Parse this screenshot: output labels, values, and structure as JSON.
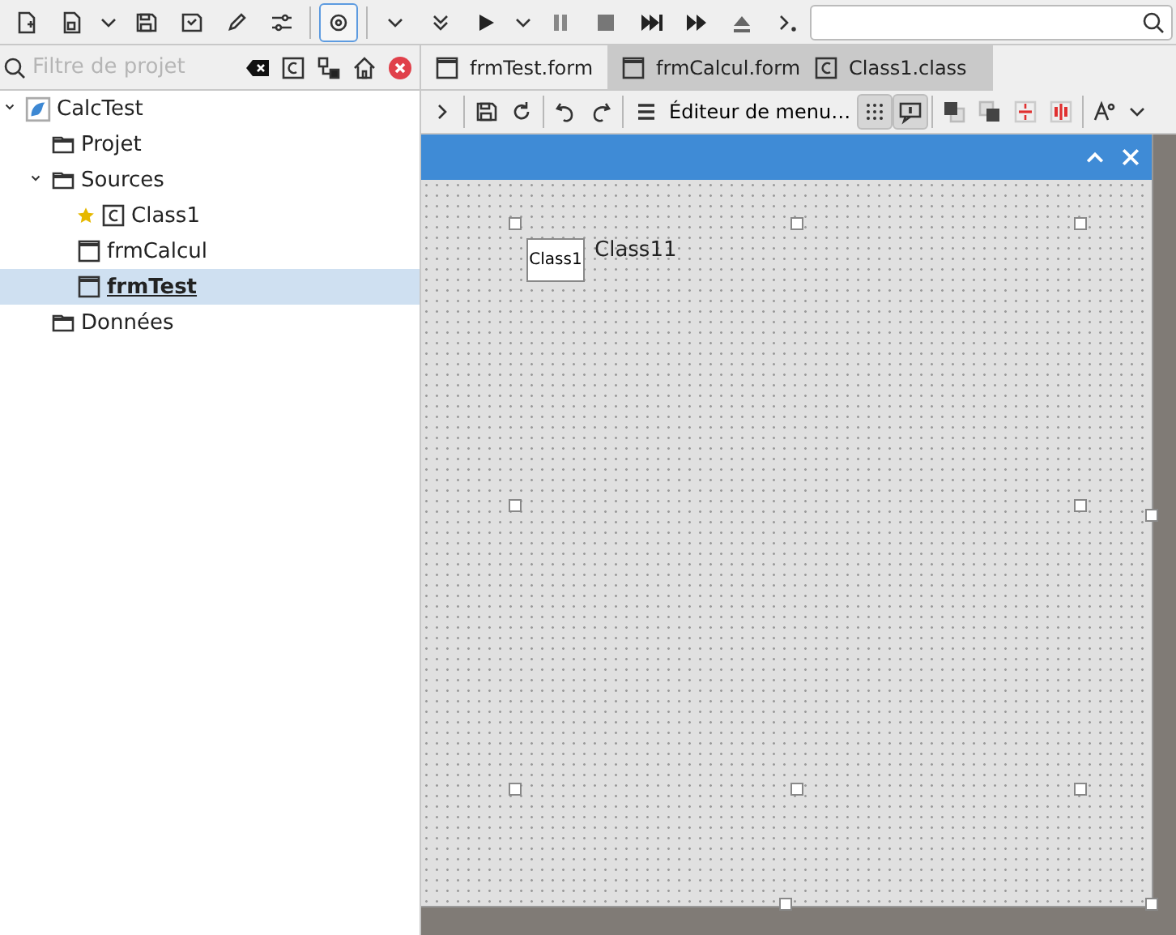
{
  "toolbar": {
    "settings_pressed": true
  },
  "project_panel": {
    "filter": {
      "placeholder": "Filtre de projet"
    },
    "tree": [
      {
        "label": "CalcTest",
        "kind": "project",
        "expanded": true,
        "selected": false,
        "starred": false,
        "children": [
          {
            "label": "Projet",
            "kind": "folder",
            "selected": false,
            "starred": false
          },
          {
            "label": "Sources",
            "kind": "folder",
            "expanded": true,
            "selected": false,
            "starred": false,
            "children": [
              {
                "label": "Class1",
                "kind": "class",
                "selected": false,
                "starred": true
              },
              {
                "label": "frmCalcul",
                "kind": "form",
                "selected": false,
                "starred": false
              },
              {
                "label": "frmTest",
                "kind": "form",
                "selected": true,
                "starred": false
              }
            ]
          },
          {
            "label": "Données",
            "kind": "folder",
            "selected": false,
            "starred": false
          }
        ]
      }
    ]
  },
  "tabs": [
    {
      "label": "frmTest.form",
      "kind": "form",
      "selected": true
    },
    {
      "label": "frmCalcul.form",
      "kind": "form",
      "selected": false
    },
    {
      "label": "Class1.class",
      "kind": "class",
      "selected": false
    }
  ],
  "editor_toolbar": {
    "menu_editor": "Éditeur de menu…",
    "grid_on": true,
    "hints_on": true
  },
  "form": {
    "controls": [
      {
        "kind": "button",
        "text": "Class1"
      },
      {
        "kind": "label",
        "text": "Class11"
      }
    ]
  }
}
